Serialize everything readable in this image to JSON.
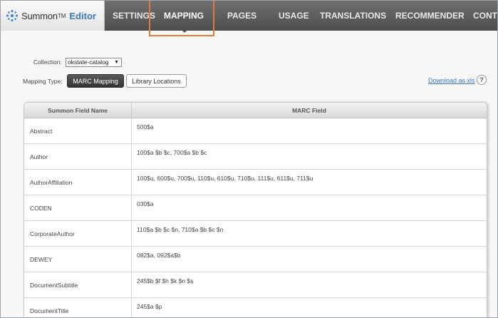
{
  "brand": {
    "name": "Summon",
    "tm": "TM",
    "product": "Editor"
  },
  "nav": {
    "items": [
      {
        "label": "SETTINGS",
        "active": false
      },
      {
        "label": "MAPPING",
        "active": true
      },
      {
        "label": "PAGES",
        "active": false
      },
      {
        "label": "USAGE",
        "active": false
      },
      {
        "label": "TRANSLATIONS",
        "active": false
      },
      {
        "label": "RECOMMENDER",
        "active": false
      },
      {
        "label": "CONT",
        "active": false
      }
    ]
  },
  "filters": {
    "collection_label": "Collection:",
    "collection_value": "okstate-catalog",
    "mapping_type_label": "Mapping Type:",
    "mapping_buttons": [
      "MARC Mapping",
      "Library Locations"
    ],
    "download_label": "Download as xls",
    "help_label": "?"
  },
  "table": {
    "headers": [
      "Summon Field Name",
      "MARC Field"
    ],
    "rows": [
      [
        "Abstract",
        "500$a"
      ],
      [
        "Author",
        "100$a $b $c, 700$a $b $c"
      ],
      [
        "AuthorAffiliation",
        "100$u, 600$u, 700$u, 110$u, 610$u, 710$u, 111$u, 611$u, 711$u"
      ],
      [
        "CODEN",
        "030$a"
      ],
      [
        "CorporateAuthor",
        "110$a $b $c $n, 710$a $b $c $n"
      ],
      [
        "DEWEY",
        "082$a, 092$a$b"
      ],
      [
        "DocumentSubtitle",
        "245$b $f $h $k $n $s"
      ],
      [
        "DocumentTitle",
        "245$a $p"
      ]
    ]
  },
  "colors": {
    "accent": "#e07b39",
    "link": "#3d78b8",
    "nav_bg": "#555555"
  }
}
